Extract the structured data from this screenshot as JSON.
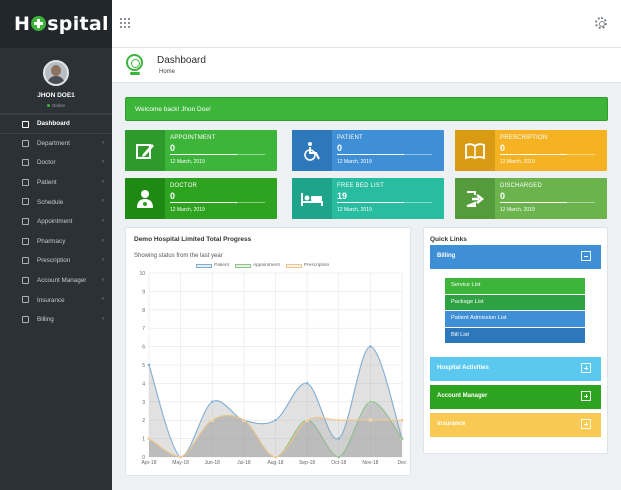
{
  "app": {
    "brand_pre": "H",
    "brand_post": "spital"
  },
  "profile": {
    "name": "JHON DOE1",
    "status": "Online"
  },
  "sidebar": {
    "items": [
      {
        "label": "Dashboard",
        "icon": "dashboard-icon",
        "active": true
      },
      {
        "label": "Department",
        "icon": "department-icon"
      },
      {
        "label": "Doctor",
        "icon": "doctor-icon"
      },
      {
        "label": "Patient",
        "icon": "patient-icon"
      },
      {
        "label": "Schedule",
        "icon": "calendar-icon"
      },
      {
        "label": "Appointment",
        "icon": "appointment-icon"
      },
      {
        "label": "Pharmacy",
        "icon": "pharmacy-icon"
      },
      {
        "label": "Prescription",
        "icon": "prescription-icon"
      },
      {
        "label": "Account Manager",
        "icon": "account-icon"
      },
      {
        "label": "Insurance",
        "icon": "insurance-icon"
      },
      {
        "label": "Billing",
        "icon": "billing-icon"
      }
    ]
  },
  "header": {
    "title": "Dashboard",
    "breadcrumb": "Home"
  },
  "welcome": "Welcome back! Jhon Doe!",
  "cards": [
    {
      "title": "APPOINTMENT",
      "value": "0",
      "date": "12 March, 2019",
      "icon": "edit-icon",
      "color": "#3db43a",
      "dark": "#2e9a2b"
    },
    {
      "title": "PATIENT",
      "value": "0",
      "date": "12 March, 2019",
      "icon": "wheelchair-icon",
      "color": "#3e8fd6",
      "dark": "#2d77bb"
    },
    {
      "title": "PRESCRIPTION",
      "value": "0",
      "date": "12 March, 2019",
      "icon": "book-icon",
      "color": "#f5b324",
      "dark": "#d99a14"
    },
    {
      "title": "DOCTOR",
      "value": "0",
      "date": "12 March, 2019",
      "icon": "doctor-icon",
      "color": "#2ea31f",
      "dark": "#1f8a13"
    },
    {
      "title": "FREE BED LIST",
      "value": "19",
      "date": "12 March, 2019",
      "icon": "bed-icon",
      "color": "#28bca0",
      "dark": "#1ea48a"
    },
    {
      "title": "DISCHARGED",
      "value": "0",
      "date": "12 March, 2019",
      "icon": "exit-icon",
      "color": "#6ab34d",
      "dark": "#559a3b"
    }
  ],
  "chart_panel": {
    "title": "Demo Hospital Limited Total Progress",
    "subtitle": "Showing status from the last year"
  },
  "chart_data": {
    "type": "area",
    "categories": [
      "Apr-18",
      "May-18",
      "Jun-18",
      "Jul-18",
      "Aug-18",
      "Sep-18",
      "Oct-18",
      "Nov-18",
      "Dec"
    ],
    "x": [
      0,
      1,
      2,
      3,
      4,
      5,
      6,
      7,
      8
    ],
    "series": [
      {
        "name": "Patient",
        "values": [
          5,
          0,
          3,
          2,
          2,
          4,
          1,
          6,
          1
        ],
        "color": "#7faed4",
        "fill": "rgba(170,170,170,0.35)"
      },
      {
        "name": "Appointment",
        "values": [
          1,
          0,
          2,
          2,
          0,
          2,
          0,
          3,
          1
        ],
        "color": "#8cc48c",
        "fill": "rgba(150,150,150,0.35)"
      },
      {
        "name": "Prescription",
        "values": [
          1,
          0,
          2,
          2,
          0,
          2,
          2,
          2,
          2
        ],
        "color": "#f0c38c",
        "fill": "rgba(160,160,160,0.25)"
      }
    ],
    "ylim": [
      0,
      10
    ],
    "yticks": [
      0,
      1,
      2,
      3,
      4,
      5,
      6,
      7,
      8,
      9,
      10
    ],
    "grid": true,
    "legend": "top"
  },
  "quick_links": {
    "title": "Quick Links",
    "sections": [
      {
        "label": "Billing",
        "color": "#3e8fd6",
        "expanded": true
      },
      {
        "label": "Hospital Activities",
        "color": "#5bc8ef",
        "expanded": false
      },
      {
        "label": "Account Manager",
        "color": "#2ea31f",
        "expanded": false
      },
      {
        "label": "Insurance",
        "color": "#f8c953",
        "expanded": false
      }
    ],
    "billing_items": [
      {
        "label": "Service List",
        "color": "#3db43a"
      },
      {
        "label": "Package List",
        "color": "#2ea143"
      },
      {
        "label": "Patient Admission List",
        "color": "#3e8fd6"
      },
      {
        "label": "Bill List",
        "color": "#2d77bb"
      }
    ]
  }
}
